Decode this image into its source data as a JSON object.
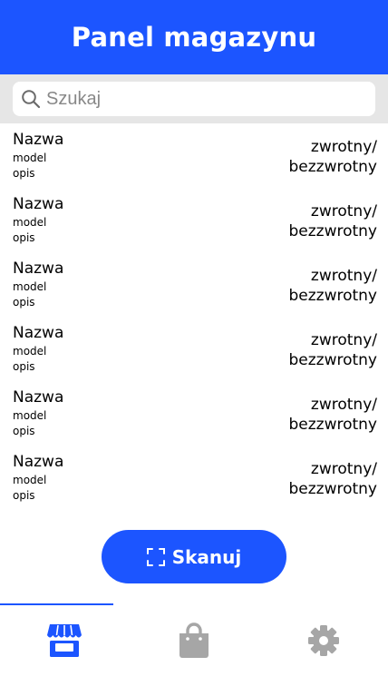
{
  "header": {
    "title": "Panel magazynu"
  },
  "search": {
    "placeholder": "Szukaj"
  },
  "items": [
    {
      "name": "Nazwa",
      "model": "model",
      "description": "opis",
      "status_line1": "zwrotny/",
      "status_line2": "bezzwrotny"
    },
    {
      "name": "Nazwa",
      "model": "model",
      "description": "opis",
      "status_line1": "zwrotny/",
      "status_line2": "bezzwrotny"
    },
    {
      "name": "Nazwa",
      "model": "model",
      "description": "opis",
      "status_line1": "zwrotny/",
      "status_line2": "bezzwrotny"
    },
    {
      "name": "Nazwa",
      "model": "model",
      "description": "opis",
      "status_line1": "zwrotny/",
      "status_line2": "bezzwrotny"
    },
    {
      "name": "Nazwa",
      "model": "model",
      "description": "opis",
      "status_line1": "zwrotny/",
      "status_line2": "bezzwrotny"
    },
    {
      "name": "Nazwa",
      "model": "model",
      "description": "opis",
      "status_line1": "zwrotny/",
      "status_line2": "bezzwrotny"
    }
  ],
  "scan_button": {
    "label": "Skanuj",
    "icon": "scan-frame-icon"
  },
  "bottom_nav": {
    "tabs": [
      {
        "icon": "store-icon",
        "active": true
      },
      {
        "icon": "shopping-bag-icon",
        "active": false
      },
      {
        "icon": "gear-icon",
        "active": false
      }
    ]
  },
  "colors": {
    "primary": "#1c55ff",
    "inactive_icon": "#a6a6a6",
    "search_background": "#e6e6e6",
    "placeholder": "#888888"
  }
}
